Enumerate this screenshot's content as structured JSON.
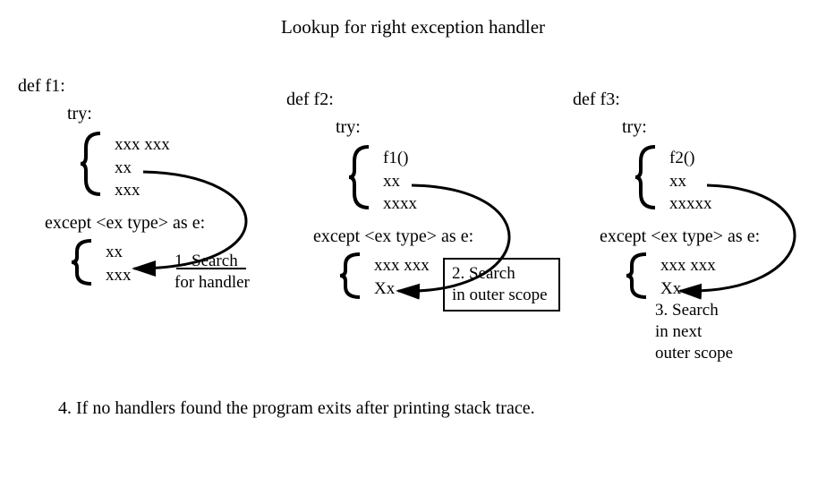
{
  "title": "Lookup for right exception handler",
  "functions": [
    {
      "def": "def f1:",
      "try_kw": "try:",
      "try_body": [
        "xxx xxx",
        "xx",
        "xxx"
      ],
      "except_kw": "except <ex type> as e:",
      "except_body": [
        "xx",
        "xxx"
      ]
    },
    {
      "def": "def f2:",
      "try_kw": "try:",
      "try_body": [
        "f1()",
        "xx",
        "xxxx"
      ],
      "except_kw": "except <ex type> as e:",
      "except_body": [
        "xxx xxx",
        "Xx"
      ]
    },
    {
      "def": "def f3:",
      "try_kw": "try:",
      "try_body": [
        "f2()",
        "xx",
        "xxxxx"
      ],
      "except_kw": "except <ex type> as e:",
      "except_body": [
        "xxx xxx",
        "Xx"
      ]
    }
  ],
  "steps": {
    "s1_line1": "1. Search",
    "s1_line2": "for handler",
    "s2_line1": "2. Search",
    "s2_line2": "in outer scope",
    "s3_line1": "3. Search",
    "s3_line2": "in next",
    "s3_line3": "outer scope"
  },
  "footer": "4. If no handlers found the program exits after printing stack trace."
}
